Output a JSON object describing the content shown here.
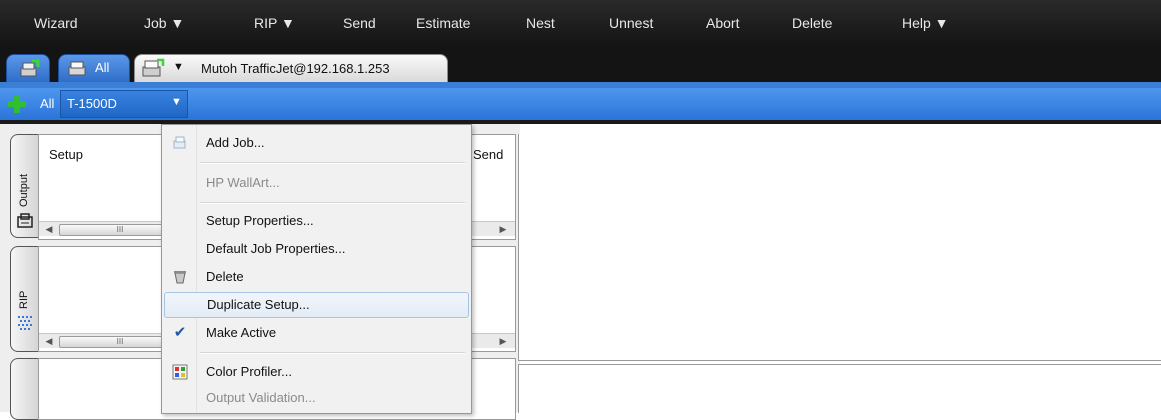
{
  "menubar": {
    "items": [
      "Wizard",
      "Job ▼",
      "RIP ▼",
      "Send",
      "Estimate",
      "Nest",
      "Unnest",
      "Abort",
      "Delete",
      "Help ▼"
    ]
  },
  "printer_tabs": {
    "all_label": "All",
    "printer_label": "Mutoh TrafficJet@192.168.1.253",
    "dropdown_arrow": "▼"
  },
  "setup_bar": {
    "all_label": "All",
    "setup_name": "T-1500D",
    "dropdown_arrow": "▼"
  },
  "output_panel": {
    "tab_label": "Output",
    "column_setup": "Setup",
    "column_send": "Send",
    "scroll_thumb": "III"
  },
  "rip_panel": {
    "tab_label": "RIP",
    "scroll_thumb": "III"
  },
  "context_menu": {
    "items": [
      {
        "label": "Add Job...",
        "icon": "add-job-icon",
        "enabled": true
      },
      {
        "label": "HP WallArt...",
        "icon": "",
        "enabled": false
      },
      {
        "label": "Setup Properties...",
        "icon": "",
        "enabled": true
      },
      {
        "label": "Default Job Properties...",
        "icon": "",
        "enabled": true
      },
      {
        "label": "Delete",
        "icon": "delete-icon",
        "enabled": true
      },
      {
        "label": "Duplicate Setup...",
        "icon": "",
        "enabled": true,
        "highlighted": true
      },
      {
        "label": "Make Active",
        "icon": "checkmark-icon",
        "enabled": true,
        "checked": true
      },
      {
        "label": "Color Profiler...",
        "icon": "color-profiler-icon",
        "enabled": true
      },
      {
        "label": "Output Validation...",
        "icon": "",
        "enabled": false
      }
    ]
  },
  "colors": {
    "menubar_bg": "#1e1e1e",
    "setup_bar_blue": "#3a86e4",
    "highlight_border": "#a8c4e4",
    "add_icon_green": "#2fbf2f"
  }
}
